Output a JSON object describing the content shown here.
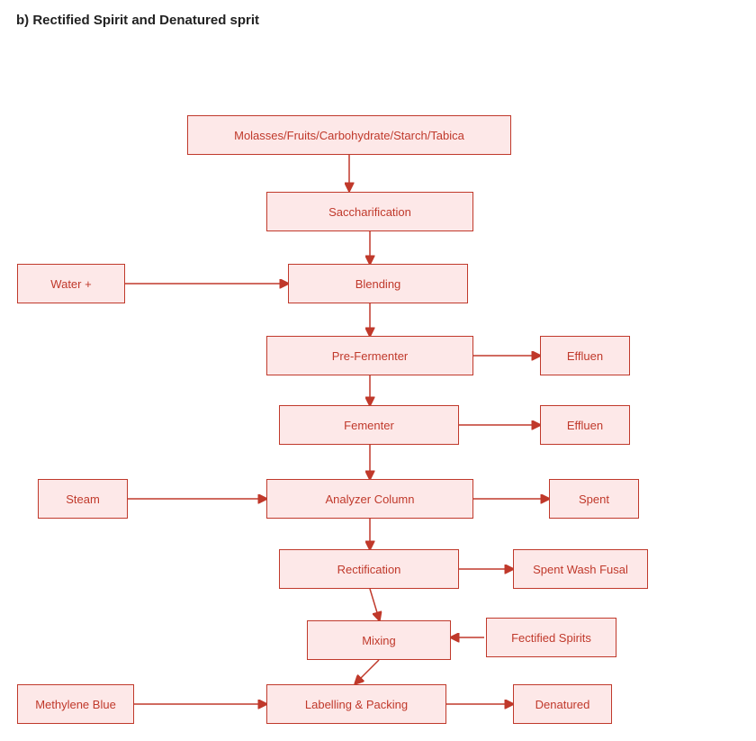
{
  "title": "b) Rectified Spirit and Denatured sprit",
  "boxes": {
    "molasses": {
      "label": "Molasses/Fruits/Carbohydrate/Starch/Tabica"
    },
    "saccharification": {
      "label": "Saccharification"
    },
    "water": {
      "label": "Water +"
    },
    "blending": {
      "label": "Blending"
    },
    "preFermenter": {
      "label": "Pre-Fermenter"
    },
    "effluen1": {
      "label": "Effluen"
    },
    "fermenter": {
      "label": "Fementer"
    },
    "effluen2": {
      "label": "Effluen"
    },
    "steam": {
      "label": "Steam"
    },
    "analyzerColumn": {
      "label": "Analyzer Column"
    },
    "spent": {
      "label": "Spent"
    },
    "rectification": {
      "label": "Rectification"
    },
    "spentWashFusal": {
      "label": "Spent Wash Fusal"
    },
    "fectifiedSpirits": {
      "label": "Fectified Spirits"
    },
    "mixing": {
      "label": "Mixing"
    },
    "methyleneBlue": {
      "label": "Methylene Blue"
    },
    "labellingPacking": {
      "label": "Labelling & Packing"
    },
    "denatured": {
      "label": "Denatured"
    }
  }
}
